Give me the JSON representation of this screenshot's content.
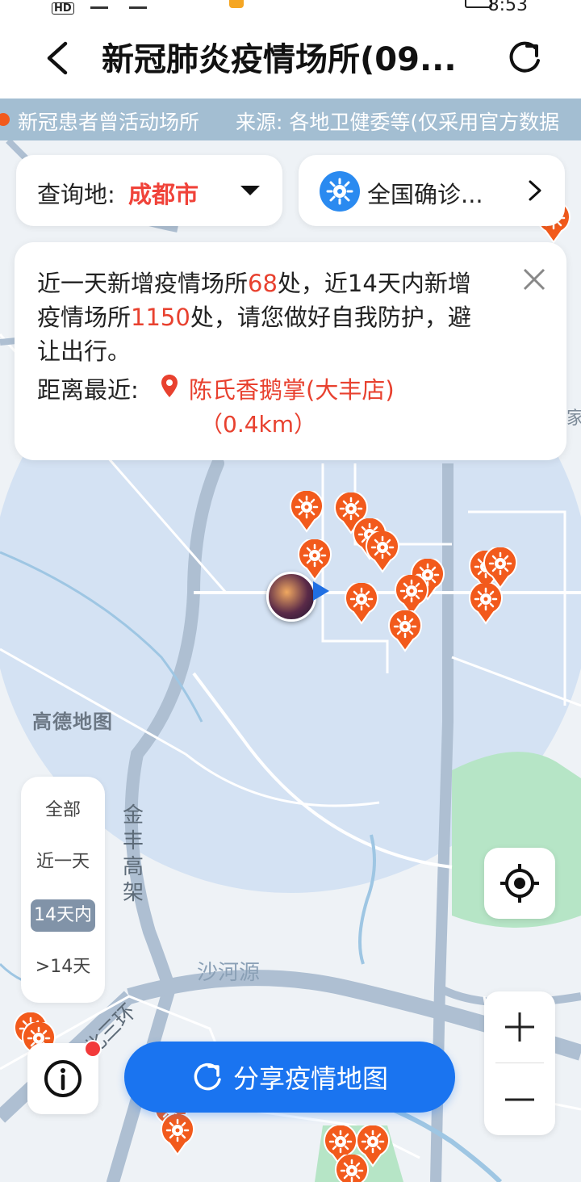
{
  "status_bar": {
    "network_badge": "HD",
    "time": "8:53"
  },
  "header": {
    "title": "新冠肺炎疫情场所(09...",
    "back_icon": "chevron-left-icon",
    "refresh_icon": "refresh-icon"
  },
  "ticker": {
    "left_text": "新冠患者曾活动场所",
    "right_text": "来源: 各地卫健委等(仅采用官方数据"
  },
  "query": {
    "label": "查询地: ",
    "city": "成都市"
  },
  "national": {
    "label": "全国确诊..."
  },
  "info_card": {
    "line_a1": "近一天新增疫情场所",
    "count_day": "68",
    "line_a2": "处，近14天内新增疫情场所",
    "count_14": "1150",
    "line_a3": "处，请您做好自我防护，避让出行。",
    "nearest_label": "距离最近: ",
    "nearest_place": "陈氏香鹅掌(大丰店)",
    "nearest_distance": "（0.4km）"
  },
  "filter": {
    "items": [
      "全部",
      "近一天",
      "14天内",
      ">14天"
    ],
    "selected": "14天内"
  },
  "map_labels": {
    "watermark": "高德地图",
    "road_1": "沙河源",
    "road_2": "金丰高架",
    "road_3": "北三环",
    "edge_label": "家"
  },
  "share_button": {
    "label": "分享疫情地图"
  },
  "colors": {
    "accent": "#1a74f0",
    "marker": "#f25a1c",
    "highlight": "#e8412f"
  }
}
